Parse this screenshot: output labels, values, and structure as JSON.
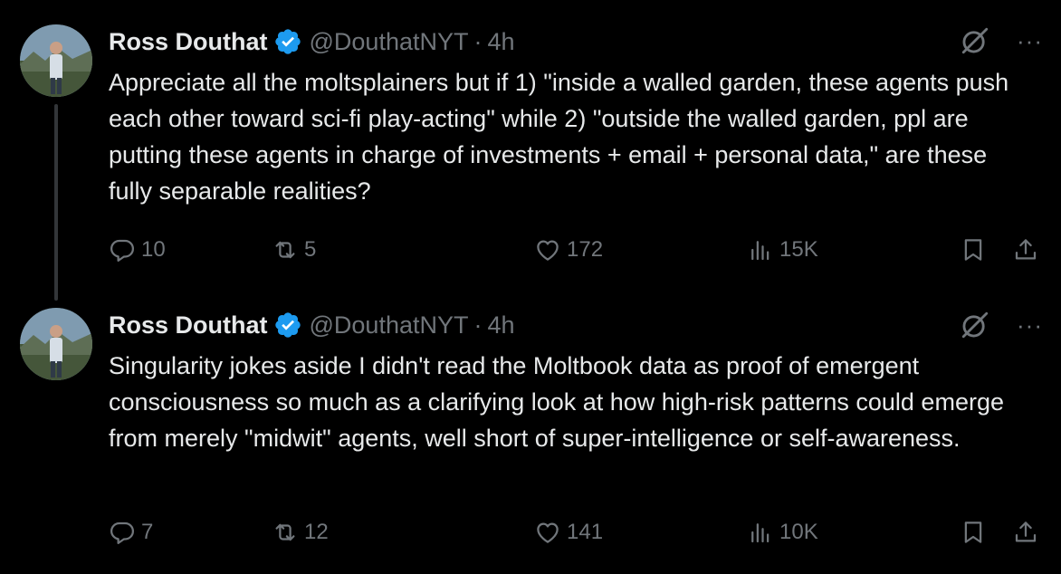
{
  "tweets": [
    {
      "author": "Ross Douthat",
      "handle": "@DouthatNYT",
      "separator": "·",
      "time": "4h",
      "text": "Appreciate all the moltsplainers but if 1) \"inside a walled garden, these agents push each other toward sci-fi play-acting\" while 2) \"outside the walled garden, ppl are putting these agents in charge of investments + email + personal data,\" are these fully separable realities?",
      "replies": "10",
      "reposts": "5",
      "likes": "172",
      "views": "15K"
    },
    {
      "author": "Ross Douthat",
      "handle": "@DouthatNYT",
      "separator": "·",
      "time": "4h",
      "text": "Singularity jokes aside I didn't read the Moltbook data as proof of emergent consciousness so much as a clarifying look at how high-risk patterns could emerge from merely \"midwit\" agents, well short of super-intelligence or self-awareness.",
      "replies": "7",
      "reposts": "12",
      "likes": "141",
      "views": "10K"
    }
  ],
  "more_label": "···",
  "colors": {
    "background": "#000000",
    "text": "#e7e9ea",
    "muted": "#71767b",
    "verified": "#1d9bf0",
    "thread_line": "#333639"
  }
}
